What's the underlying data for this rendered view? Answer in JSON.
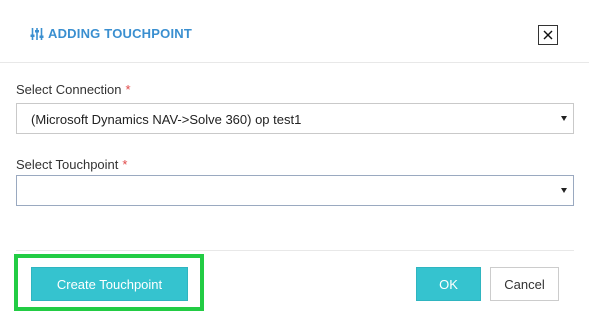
{
  "dialog": {
    "title": "ADDING TOUCHPOINT",
    "title_icon": "sliders-icon",
    "close_label": "✕",
    "accent_color": "#3a8fd0"
  },
  "form": {
    "connection": {
      "label": "Select Connection",
      "required_mark": "*",
      "value": "(Microsoft Dynamics NAV->Solve 360) op test1"
    },
    "touchpoint": {
      "label": "Select Touchpoint",
      "required_mark": "*",
      "value": ""
    }
  },
  "footer": {
    "create_label": "Create Touchpoint",
    "ok_label": "OK",
    "cancel_label": "Cancel",
    "primary_color": "#35c3cf",
    "highlight_color": "#22cc44"
  }
}
